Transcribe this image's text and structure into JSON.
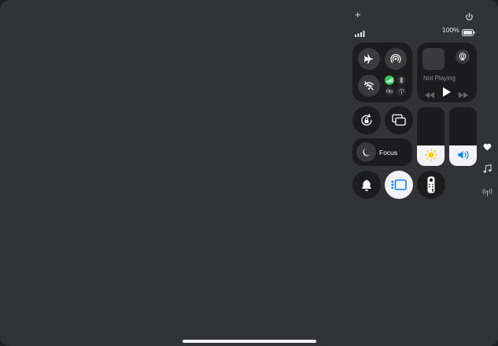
{
  "status": {
    "add_symbol": "+",
    "battery_text": "100%"
  },
  "media": {
    "now_playing": "Not Playing"
  },
  "focus": {
    "label": "Focus"
  },
  "colors": {
    "cellular_active": "#34c759",
    "volume_icon": "#0a84ff",
    "brightness_icon": "#ffcc00"
  },
  "brightness": {
    "level": 0.35
  },
  "volume": {
    "level": 0.35
  },
  "side_icons": [
    "heart-icon",
    "music-note-icon",
    "broadcast-icon"
  ]
}
